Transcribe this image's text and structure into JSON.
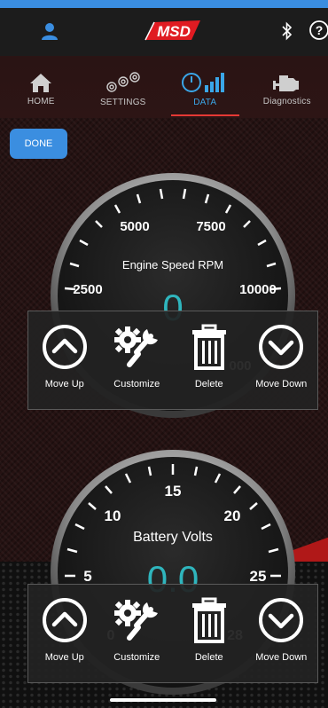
{
  "brand": {
    "logo_text": "MSD",
    "logo_color": "#e01b22"
  },
  "header": {
    "profile_icon": "person-icon",
    "bluetooth_icon": "bluetooth-icon",
    "help_icon": "help-icon",
    "help_glyph": "?"
  },
  "tabs": [
    {
      "label": "HOME",
      "icon": "home-icon",
      "active": false
    },
    {
      "label": "SETTINGS",
      "icon": "gears-icon",
      "active": false
    },
    {
      "label": "DATA",
      "icon": "gauge-bars-icon",
      "active": true
    },
    {
      "label": "Diagnostics",
      "icon": "engine-icon",
      "active": false
    }
  ],
  "done_label": "DONE",
  "gauges": [
    {
      "title": "Engine Speed RPM",
      "value": "0",
      "scale_labels": [
        "2500",
        "5000",
        "7500",
        "10000"
      ],
      "hidden_label": "000"
    },
    {
      "title": "Battery Volts",
      "value": "0.0",
      "scale_labels": [
        "5",
        "10",
        "15",
        "20",
        "25"
      ],
      "hidden_labels": [
        "0",
        "28"
      ]
    }
  ],
  "actions": {
    "move_up": "Move Up",
    "customize": "Customize",
    "delete": "Delete",
    "move_down": "Move Down"
  },
  "colors": {
    "accent": "#3b8ee0",
    "value": "#2fb5bd",
    "active_tab_underline": "#e53935"
  }
}
